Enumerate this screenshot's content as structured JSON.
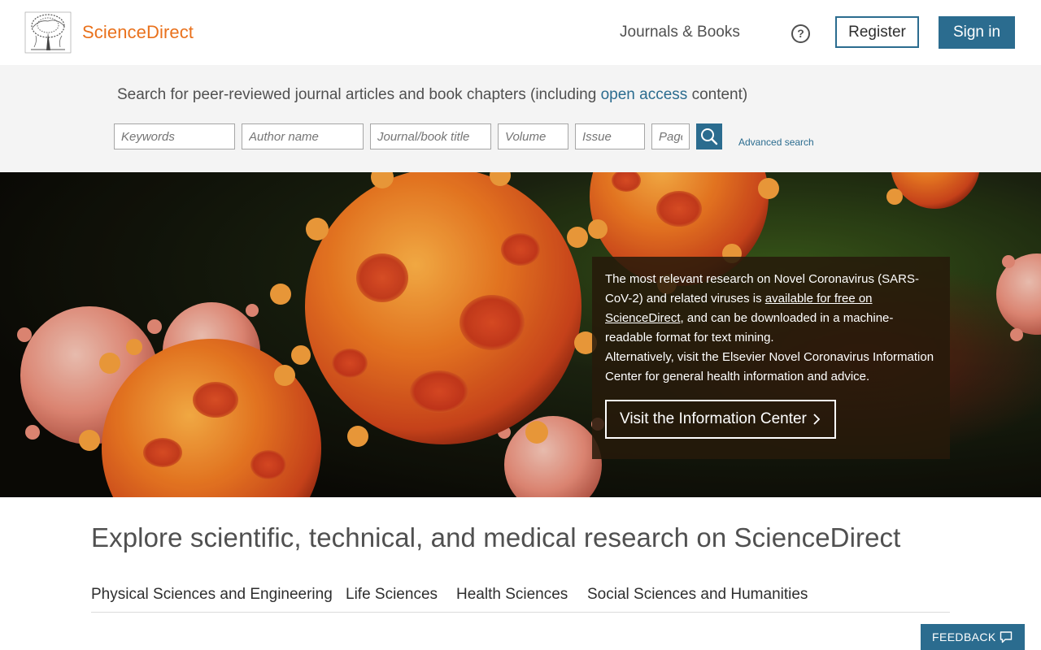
{
  "header": {
    "brand": "ScienceDirect",
    "nav_journals": "Journals & Books",
    "help_glyph": "?",
    "register_label": "Register",
    "signin_label": "Sign in"
  },
  "search": {
    "heading_before": "Search for peer-reviewed journal articles and book chapters (including ",
    "heading_link": "open access",
    "heading_after": " content)",
    "placeholders": {
      "keywords": "Keywords",
      "author": "Author name",
      "journal": "Journal/book title",
      "volume": "Volume",
      "issue": "Issue",
      "pages": "Pages"
    },
    "advanced_label": "Advanced search"
  },
  "hero": {
    "text_1": "The most relevant research on Novel Coronavirus (SARS-CoV-2) and related viruses is ",
    "link": "available for free on ScienceDirect",
    "text_2": ", and can be downloaded in a machine-readable format for text mining.",
    "text_3": "Alternatively, visit the Elsevier Novel Coronavirus Information Center for general health information and advice.",
    "button_label": "Visit the Information Center"
  },
  "explore": {
    "title": "Explore scientific, technical, and medical research on ScienceDirect",
    "tabs": [
      "Physical Sciences and Engineering",
      "Life Sciences",
      "Health Sciences",
      "Social Sciences and Humanities"
    ]
  },
  "feedback": {
    "label": "FEEDBACK"
  },
  "colors": {
    "brand_orange": "#e9711c",
    "primary_blue": "#2b6c8f"
  },
  "icons": [
    "elsevier-tree-logo",
    "help-icon",
    "search-icon",
    "chevron-right-icon",
    "speech-bubble-icon"
  ]
}
